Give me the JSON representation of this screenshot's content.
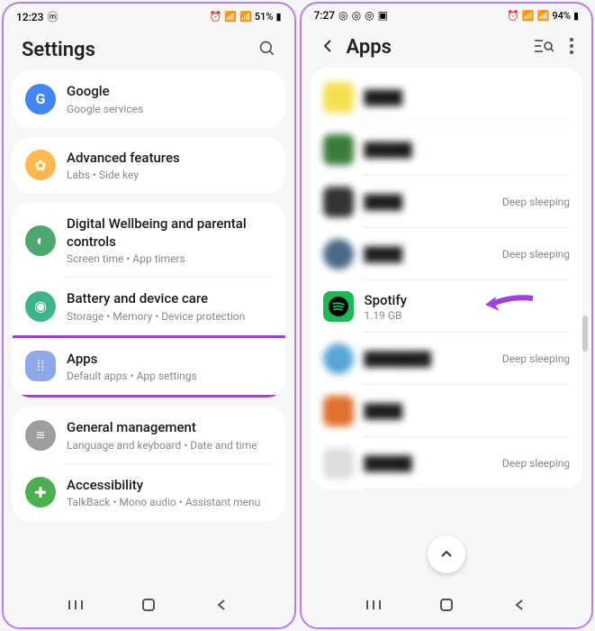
{
  "left": {
    "status": {
      "time": "12:23",
      "battery": "51%"
    },
    "header": {
      "title": "Settings"
    },
    "groups": [
      [
        {
          "title": "Google",
          "subtitle": "Google services"
        }
      ],
      [
        {
          "title": "Advanced features",
          "subtitle": "Labs • Side key"
        }
      ],
      [
        {
          "title": "Digital Wellbeing and parental controls",
          "subtitle": "Screen time • App timers"
        },
        {
          "title": "Battery and device care",
          "subtitle": "Storage • Memory • Device protection"
        },
        {
          "title": "Apps",
          "subtitle": "Default apps • App settings",
          "highlight": true
        }
      ],
      [
        {
          "title": "General management",
          "subtitle": "Language and keyboard • Date and time"
        },
        {
          "title": "Accessibility",
          "subtitle": "TalkBack • Mono audio • Assistant menu"
        }
      ]
    ]
  },
  "right": {
    "status": {
      "time": "7:27",
      "battery": "94%"
    },
    "header": {
      "title": "Apps"
    },
    "apps": [
      {
        "blurred": true,
        "status": ""
      },
      {
        "blurred": true,
        "status": ""
      },
      {
        "blurred": true,
        "status": "Deep sleeping"
      },
      {
        "blurred": true,
        "status": "Deep sleeping"
      },
      {
        "title": "Spotify",
        "subtitle": "1.19 GB",
        "blurred": false,
        "arrow": true
      },
      {
        "blurred": true,
        "status": "Deep sleeping"
      },
      {
        "blurred": true,
        "status": ""
      },
      {
        "blurred": true,
        "status": "Deep sleeping"
      }
    ]
  }
}
